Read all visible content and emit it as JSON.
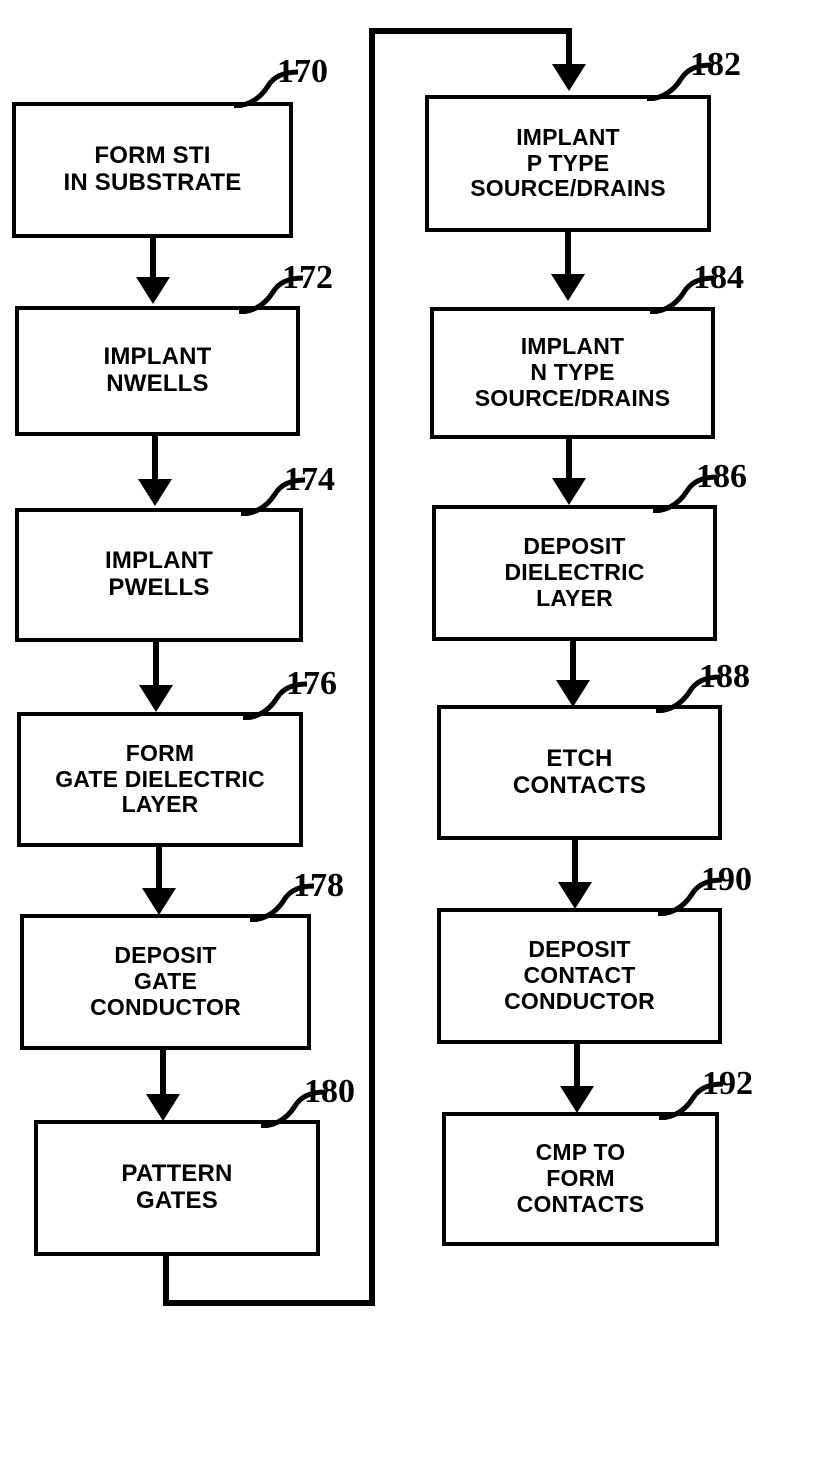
{
  "figure": {
    "type": "patent-process-flowchart",
    "title": "",
    "orientation": "two-column, left column flows into right column"
  },
  "nodes": [
    {
      "id": "170",
      "column": "left",
      "ref": "170",
      "lines": [
        "FORM STI",
        "IN SUBSTRATE"
      ]
    },
    {
      "id": "172",
      "column": "left",
      "ref": "172",
      "lines": [
        "IMPLANT",
        "NWELLS"
      ]
    },
    {
      "id": "174",
      "column": "left",
      "ref": "174",
      "lines": [
        "IMPLANT",
        "PWELLS"
      ]
    },
    {
      "id": "176",
      "column": "left",
      "ref": "176",
      "lines": [
        "FORM",
        "GATE DIELECTRIC",
        "LAYER"
      ]
    },
    {
      "id": "178",
      "column": "left",
      "ref": "178",
      "lines": [
        "DEPOSIT",
        "GATE",
        "CONDUCTOR"
      ]
    },
    {
      "id": "180",
      "column": "left",
      "ref": "180",
      "lines": [
        "PATTERN",
        "GATES"
      ]
    },
    {
      "id": "182",
      "column": "right",
      "ref": "182",
      "lines": [
        "IMPLANT",
        "P TYPE",
        "SOURCE/DRAINS"
      ]
    },
    {
      "id": "184",
      "column": "right",
      "ref": "184",
      "lines": [
        "IMPLANT",
        "N TYPE",
        "SOURCE/DRAINS"
      ]
    },
    {
      "id": "186",
      "column": "right",
      "ref": "186",
      "lines": [
        "DEPOSIT",
        "DIELECTRIC",
        "LAYER"
      ]
    },
    {
      "id": "188",
      "column": "right",
      "ref": "188",
      "lines": [
        "ETCH",
        "CONTACTS"
      ]
    },
    {
      "id": "190",
      "column": "right",
      "ref": "190",
      "lines": [
        "DEPOSIT",
        "CONTACT",
        "CONDUCTOR"
      ]
    },
    {
      "id": "192",
      "column": "right",
      "ref": "192",
      "lines": [
        "CMP TO",
        "FORM",
        "CONTACTS"
      ]
    }
  ],
  "edges": [
    {
      "from": "170",
      "to": "172",
      "kind": "arrow-down"
    },
    {
      "from": "172",
      "to": "174",
      "kind": "arrow-down"
    },
    {
      "from": "174",
      "to": "176",
      "kind": "arrow-down"
    },
    {
      "from": "176",
      "to": "178",
      "kind": "arrow-down"
    },
    {
      "from": "178",
      "to": "180",
      "kind": "arrow-down"
    },
    {
      "from": "180",
      "to": "182",
      "kind": "routed-around-left-column"
    },
    {
      "from": "182",
      "to": "184",
      "kind": "arrow-down"
    },
    {
      "from": "184",
      "to": "186",
      "kind": "arrow-down"
    },
    {
      "from": "186",
      "to": "188",
      "kind": "arrow-down"
    },
    {
      "from": "188",
      "to": "190",
      "kind": "arrow-down"
    },
    {
      "from": "190",
      "to": "192",
      "kind": "arrow-down"
    }
  ],
  "colors": {
    "ink": "#000000",
    "paper": "#ffffff"
  }
}
